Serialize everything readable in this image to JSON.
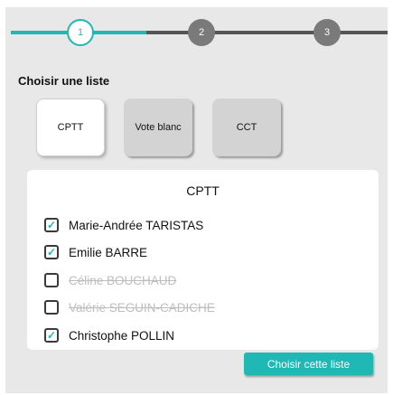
{
  "stepper": {
    "steps": [
      {
        "number": "1",
        "state": "active"
      },
      {
        "number": "2",
        "state": "inactive"
      },
      {
        "number": "3",
        "state": "inactive"
      }
    ],
    "accent_color": "#1fb8b5"
  },
  "choose_list_label": "Choisir une liste",
  "lists": [
    {
      "label": "CPTT",
      "selected": true
    },
    {
      "label": "Vote blanc",
      "selected": false
    },
    {
      "label": "CCT",
      "selected": false
    }
  ],
  "panel": {
    "title": "CPTT",
    "candidates": [
      {
        "name": "Marie-Andrée TARISTAS",
        "checked": true,
        "struck": false,
        "check_icon": "checkmark-icon"
      },
      {
        "name": "Emilie BARRE",
        "checked": true,
        "struck": false,
        "check_icon": "checkmark-icon"
      },
      {
        "name": "Céline BOUCHAUD",
        "checked": false,
        "struck": true
      },
      {
        "name": "Valérie SEGUIN-CADICHE",
        "checked": false,
        "struck": true
      },
      {
        "name": "Christophe POLLIN",
        "checked": true,
        "struck": false,
        "check_icon": "checkmark-icon"
      }
    ]
  },
  "submit_label": "Choisir cette liste"
}
